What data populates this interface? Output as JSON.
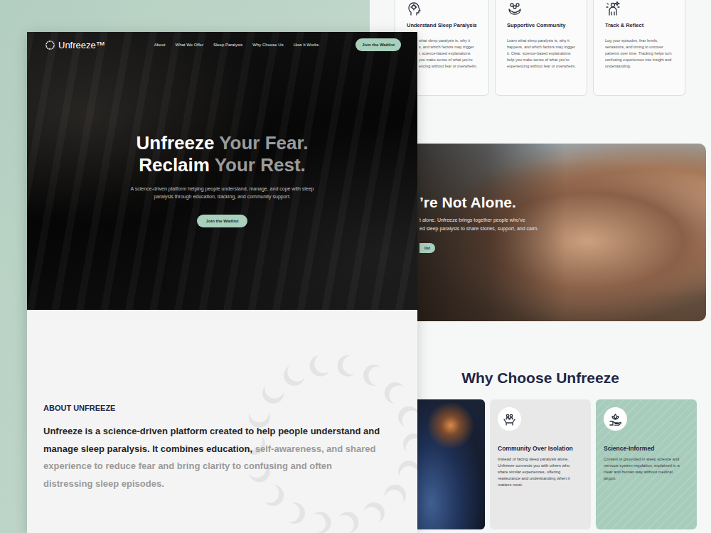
{
  "nav": {
    "logo": "Unfreeze™",
    "links": [
      "About",
      "What We Offer",
      "Sleep Paralysis",
      "Why Choose Us",
      "How It Works"
    ],
    "cta": "Join the Waitlist"
  },
  "hero": {
    "headline": [
      {
        "strong": "Unfreeze",
        "soft": "Your Fear."
      },
      {
        "strong": "Reclaim",
        "soft": "Your Rest."
      }
    ],
    "subtitle": "A science-driven platform helping people understand, manage, and cope with sleep paralysis through education, tracking, and community support.",
    "cta": "Join the Waitlist"
  },
  "about": {
    "label": "ABOUT UNFREEZE",
    "strong": "Unfreeze is a science-driven platform created to help people understand and manage sleep paralysis. It combines education, ",
    "soft": "self-awareness, and shared experience to reduce fear and bring clarity to confusing and often distressing sleep episodes."
  },
  "features": [
    {
      "title": "Understand Sleep Paralysis",
      "lines": [
        "what sleep paralysis is, why it",
        "s, and which factors may trigger",
        "r, science-based explanations",
        "you make sense of what you’re",
        "encing without fear or overwhelm."
      ]
    },
    {
      "title": "Supportive Community",
      "lines": [
        "Learn what sleep paralysis is, why it",
        "happens, and which factors may trigger",
        "it. Clear, science-based explanations",
        "help you make sense of what you’re",
        "experiencing without fear or overwhelm."
      ]
    },
    {
      "title": "Track & Reflect",
      "lines": [
        "Log your episodes, fear levels,",
        "sensations, and timing to uncover",
        "patterns over time. Tracking helps turn",
        "confusing experiences into insight and",
        "understanding."
      ]
    }
  ],
  "community": {
    "title": "’re Not Alone.",
    "lines": [
      "t alone. Unfreeze brings together people who’ve",
      "ed sleep paralysis to share stories, support, and calm."
    ],
    "cta": "list"
  },
  "why": {
    "title": "Why Choose Unfreeze",
    "cards": [
      {
        "title": "Community Over Isolation",
        "lines": [
          "Instead of facing sleep paralysis alone,",
          "Unfreeze connects you with others who",
          "share similar experiences, offering",
          "reassurance and understanding when it",
          "matters most."
        ]
      },
      {
        "title": "Science-Informed",
        "lines": [
          "Content is grounded in sleep science and",
          "nervous system regulation, explained in a",
          "clear and human way without medical",
          "jargon."
        ]
      }
    ]
  }
}
